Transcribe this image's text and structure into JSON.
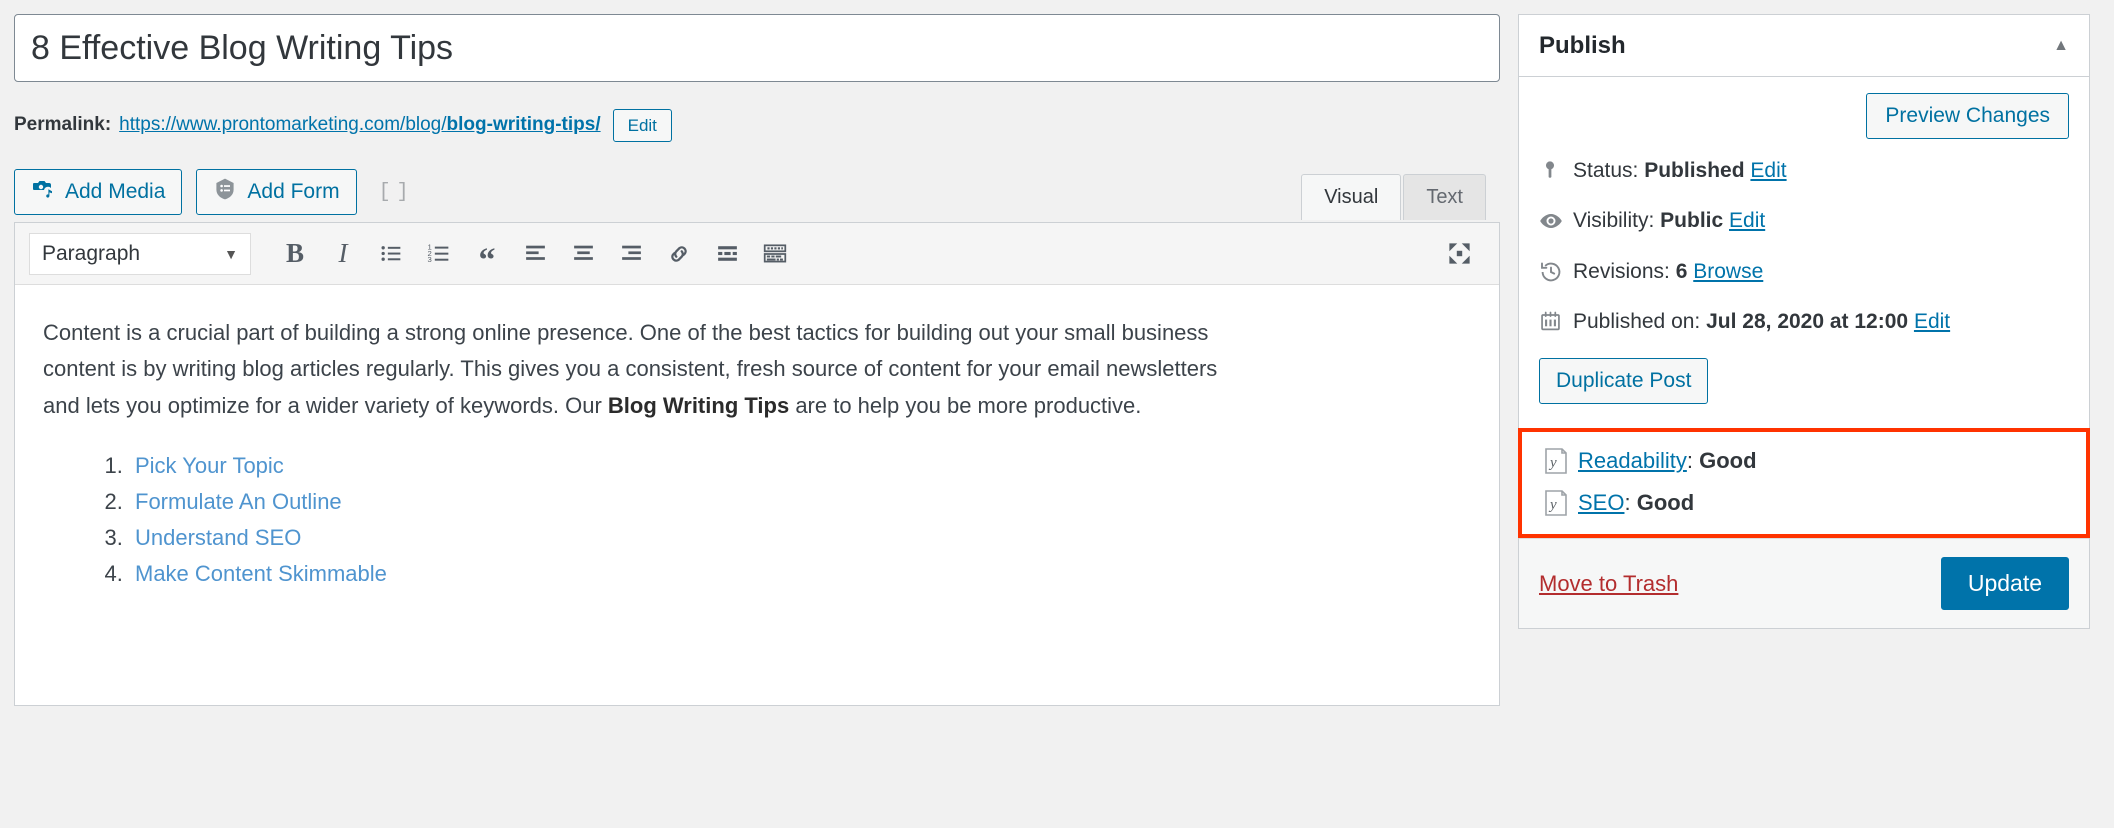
{
  "post": {
    "title": "8 Effective Blog Writing Tips",
    "permalink_label": "Permalink:",
    "permalink_base": "https://www.prontomarketing.com/blog/",
    "permalink_slug": "blog-writing-tips/",
    "edit_slug_label": "Edit"
  },
  "media_bar": {
    "add_media_label": "Add Media",
    "add_form_label": "Add Form",
    "shortcode_icon": "shortcode-icon"
  },
  "tabs": {
    "visual": "Visual",
    "text": "Text",
    "active": "Visual"
  },
  "toolbar": {
    "format_select": "Paragraph",
    "bold": "B",
    "italic": "I",
    "bullet_list": "bullet-list-icon",
    "numbered_list": "numbered-list-icon",
    "blockquote": "“",
    "align_left": "align-left-icon",
    "align_center": "align-center-icon",
    "align_right": "align-right-icon",
    "insert_link": "link-icon",
    "read_more": "read-more-icon",
    "toolbar_toggle": "keyboard-toolbar-toggle-icon",
    "fullscreen": "fullscreen-icon"
  },
  "content": {
    "paragraph_part1": "Content is a crucial part of building a strong online presence. One of the best tactics for building out your small business content is by writing blog articles regularly. This gives you a consistent, fresh source of content for your email newsletters and lets you optimize for a wider variety of keywords. Our ",
    "paragraph_bold": "Blog Writing Tips",
    "paragraph_part2": " are to help you be more productive.",
    "list": [
      "Pick Your Topic",
      "Formulate An Outline",
      "Understand SEO",
      "Make Content Skimmable"
    ]
  },
  "publish": {
    "panel_title": "Publish",
    "toggle_icon": "chevron-up-icon",
    "preview_label": "Preview Changes",
    "status_label": "Status:",
    "status_value": "Published",
    "status_edit": "Edit",
    "visibility_label": "Visibility:",
    "visibility_value": "Public",
    "visibility_edit": "Edit",
    "revisions_label": "Revisions:",
    "revisions_value": "6",
    "revisions_browse": "Browse",
    "published_label": "Published on:",
    "published_value": "Jul 28, 2020 at 12:00",
    "published_edit": "Edit",
    "duplicate_label": "Duplicate Post",
    "trash_label": "Move to Trash",
    "update_label": "Update"
  },
  "yoast": {
    "highlight_color": "#ff3300",
    "readability_label": "Readability",
    "readability_sep": ": ",
    "readability_value": "Good",
    "seo_label": "SEO",
    "seo_sep": ": ",
    "seo_value": "Good"
  }
}
